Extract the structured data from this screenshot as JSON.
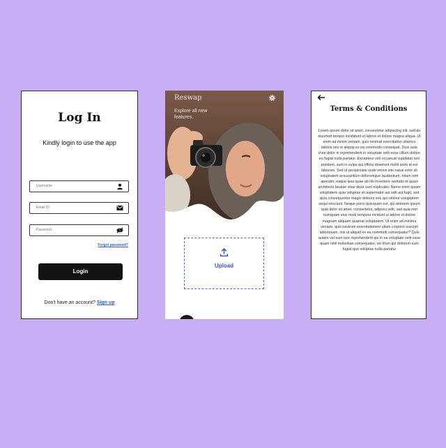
{
  "login": {
    "title": "Log In",
    "subtitle": "Kindly login to use the app",
    "username_placeholder": "Username",
    "email_placeholder": "Email ID",
    "password_placeholder": "Password",
    "forgot": "Forgot password?",
    "button": "Login",
    "signup_prompt": "Don't have an account?",
    "signup_link": "Sign up"
  },
  "upload": {
    "app_name": "Reswap",
    "tagline": "Explore all new features.",
    "upload_label": "Upload"
  },
  "terms": {
    "title": "Terms & Conditions",
    "body": "Lorem ipsum dolor sit amet, consectetur adipiscing elit, sed do eiusmod tempor incididunt ut labore et dolore magna aliqua. Ut enim ad minim veniam, quis nostrud exercitation ullamco laboris nisi ut aliquip ex ea commodo consequat. Duis aute irure dolor in reprehenderit in voluptate velit esse cillum dolore eu fugiat nulla pariatur. Excepteur sint occaecat cupidatat non proident, sunt in culpa qui officia deserunt mollit anim id est laborum. Sed ut perspiciatis unde omnis iste natus error sit voluptatem accusantium doloremque laudantium, totam rem aperiam, eaque ipsa quae ab illo inventore veritatis et quasi architecto beatae vitae dicta sunt explicabo. Nemo enim ipsam voluptatem quia voluptas sit aspernatur aut odit aut fugit, sed quia consequuntur magni dolores eos qui ratione voluptatem sequi nesciunt. Neque porro quisquam est, qui dolorem ipsum quia dolor sit amet, consectetur, adipisci velit, sed quia non numquam eius modi tempora incidunt ut labore et dolore magnam aliquam quaerat voluptatem. Ut enim ad minima veniam, quis nostrum exercitationem ullam corporis suscipit laboriosam, nisi ut aliquid ex ea commodi consequatur? Quis autem vel eum iure reprehenderit qui in ea voluptate velit esse quam nihil molestiae consequatur, vel illum qui dolorem eum fugiat quo voluptas nulla pariatur"
  },
  "colors": {
    "background": "#c7aef5",
    "link": "#2b5fd9",
    "button": "#121212",
    "upload_accent": "#4a67d8"
  },
  "icons": [
    "person-icon",
    "mail-icon",
    "eye-off-icon",
    "gear-icon",
    "upload-icon",
    "back-arrow-icon"
  ]
}
